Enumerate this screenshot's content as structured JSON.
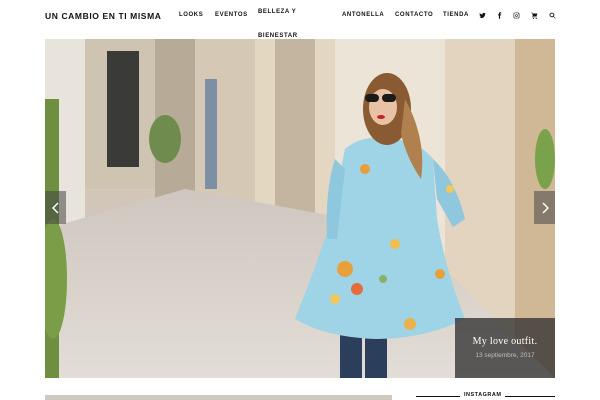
{
  "site": {
    "logo": "UN CAMBIO EN TI MISMA"
  },
  "nav": {
    "looks": "LOOKS",
    "eventos": "EVENTOS",
    "belleza": "BELLEZA Y BIENESTAR",
    "antonella": "ANTONELLA",
    "contacto": "CONTACTO",
    "tienda": "TIENDA",
    "icons": [
      "twitter-icon",
      "facebook-icon",
      "instagram-icon",
      "cart-icon",
      "search-icon"
    ]
  },
  "slider": {
    "title": "My love outfit.",
    "date": "13 septiembre, 2017"
  },
  "sidebar": {
    "instagram_title": "INSTAGRAM"
  },
  "colors": {
    "dress": "#9fd3e6",
    "caption_bg": "#333333",
    "arrow_bg": "#464646"
  }
}
